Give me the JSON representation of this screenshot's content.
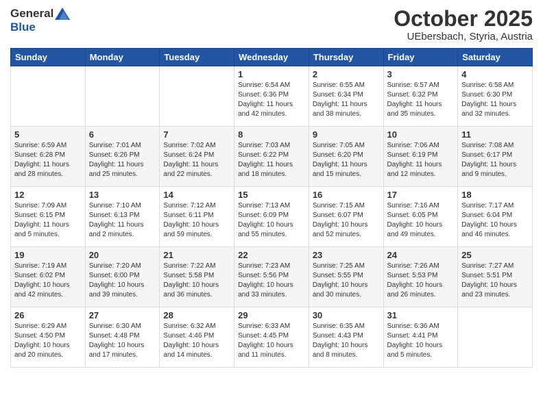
{
  "header": {
    "logo_line1": "General",
    "logo_line2": "Blue",
    "month": "October 2025",
    "location": "UEbersbach, Styria, Austria"
  },
  "weekdays": [
    "Sunday",
    "Monday",
    "Tuesday",
    "Wednesday",
    "Thursday",
    "Friday",
    "Saturday"
  ],
  "weeks": [
    [
      {
        "day": "",
        "info": ""
      },
      {
        "day": "",
        "info": ""
      },
      {
        "day": "",
        "info": ""
      },
      {
        "day": "1",
        "info": "Sunrise: 6:54 AM\nSunset: 6:36 PM\nDaylight: 11 hours\nand 42 minutes."
      },
      {
        "day": "2",
        "info": "Sunrise: 6:55 AM\nSunset: 6:34 PM\nDaylight: 11 hours\nand 38 minutes."
      },
      {
        "day": "3",
        "info": "Sunrise: 6:57 AM\nSunset: 6:32 PM\nDaylight: 11 hours\nand 35 minutes."
      },
      {
        "day": "4",
        "info": "Sunrise: 6:58 AM\nSunset: 6:30 PM\nDaylight: 11 hours\nand 32 minutes."
      }
    ],
    [
      {
        "day": "5",
        "info": "Sunrise: 6:59 AM\nSunset: 6:28 PM\nDaylight: 11 hours\nand 28 minutes."
      },
      {
        "day": "6",
        "info": "Sunrise: 7:01 AM\nSunset: 6:26 PM\nDaylight: 11 hours\nand 25 minutes."
      },
      {
        "day": "7",
        "info": "Sunrise: 7:02 AM\nSunset: 6:24 PM\nDaylight: 11 hours\nand 22 minutes."
      },
      {
        "day": "8",
        "info": "Sunrise: 7:03 AM\nSunset: 6:22 PM\nDaylight: 11 hours\nand 18 minutes."
      },
      {
        "day": "9",
        "info": "Sunrise: 7:05 AM\nSunset: 6:20 PM\nDaylight: 11 hours\nand 15 minutes."
      },
      {
        "day": "10",
        "info": "Sunrise: 7:06 AM\nSunset: 6:19 PM\nDaylight: 11 hours\nand 12 minutes."
      },
      {
        "day": "11",
        "info": "Sunrise: 7:08 AM\nSunset: 6:17 PM\nDaylight: 11 hours\nand 9 minutes."
      }
    ],
    [
      {
        "day": "12",
        "info": "Sunrise: 7:09 AM\nSunset: 6:15 PM\nDaylight: 11 hours\nand 5 minutes."
      },
      {
        "day": "13",
        "info": "Sunrise: 7:10 AM\nSunset: 6:13 PM\nDaylight: 11 hours\nand 2 minutes."
      },
      {
        "day": "14",
        "info": "Sunrise: 7:12 AM\nSunset: 6:11 PM\nDaylight: 10 hours\nand 59 minutes."
      },
      {
        "day": "15",
        "info": "Sunrise: 7:13 AM\nSunset: 6:09 PM\nDaylight: 10 hours\nand 55 minutes."
      },
      {
        "day": "16",
        "info": "Sunrise: 7:15 AM\nSunset: 6:07 PM\nDaylight: 10 hours\nand 52 minutes."
      },
      {
        "day": "17",
        "info": "Sunrise: 7:16 AM\nSunset: 6:05 PM\nDaylight: 10 hours\nand 49 minutes."
      },
      {
        "day": "18",
        "info": "Sunrise: 7:17 AM\nSunset: 6:04 PM\nDaylight: 10 hours\nand 46 minutes."
      }
    ],
    [
      {
        "day": "19",
        "info": "Sunrise: 7:19 AM\nSunset: 6:02 PM\nDaylight: 10 hours\nand 42 minutes."
      },
      {
        "day": "20",
        "info": "Sunrise: 7:20 AM\nSunset: 6:00 PM\nDaylight: 10 hours\nand 39 minutes."
      },
      {
        "day": "21",
        "info": "Sunrise: 7:22 AM\nSunset: 5:58 PM\nDaylight: 10 hours\nand 36 minutes."
      },
      {
        "day": "22",
        "info": "Sunrise: 7:23 AM\nSunset: 5:56 PM\nDaylight: 10 hours\nand 33 minutes."
      },
      {
        "day": "23",
        "info": "Sunrise: 7:25 AM\nSunset: 5:55 PM\nDaylight: 10 hours\nand 30 minutes."
      },
      {
        "day": "24",
        "info": "Sunrise: 7:26 AM\nSunset: 5:53 PM\nDaylight: 10 hours\nand 26 minutes."
      },
      {
        "day": "25",
        "info": "Sunrise: 7:27 AM\nSunset: 5:51 PM\nDaylight: 10 hours\nand 23 minutes."
      }
    ],
    [
      {
        "day": "26",
        "info": "Sunrise: 6:29 AM\nSunset: 4:50 PM\nDaylight: 10 hours\nand 20 minutes."
      },
      {
        "day": "27",
        "info": "Sunrise: 6:30 AM\nSunset: 4:48 PM\nDaylight: 10 hours\nand 17 minutes."
      },
      {
        "day": "28",
        "info": "Sunrise: 6:32 AM\nSunset: 4:46 PM\nDaylight: 10 hours\nand 14 minutes."
      },
      {
        "day": "29",
        "info": "Sunrise: 6:33 AM\nSunset: 4:45 PM\nDaylight: 10 hours\nand 11 minutes."
      },
      {
        "day": "30",
        "info": "Sunrise: 6:35 AM\nSunset: 4:43 PM\nDaylight: 10 hours\nand 8 minutes."
      },
      {
        "day": "31",
        "info": "Sunrise: 6:36 AM\nSunset: 4:41 PM\nDaylight: 10 hours\nand 5 minutes."
      },
      {
        "day": "",
        "info": ""
      }
    ]
  ]
}
